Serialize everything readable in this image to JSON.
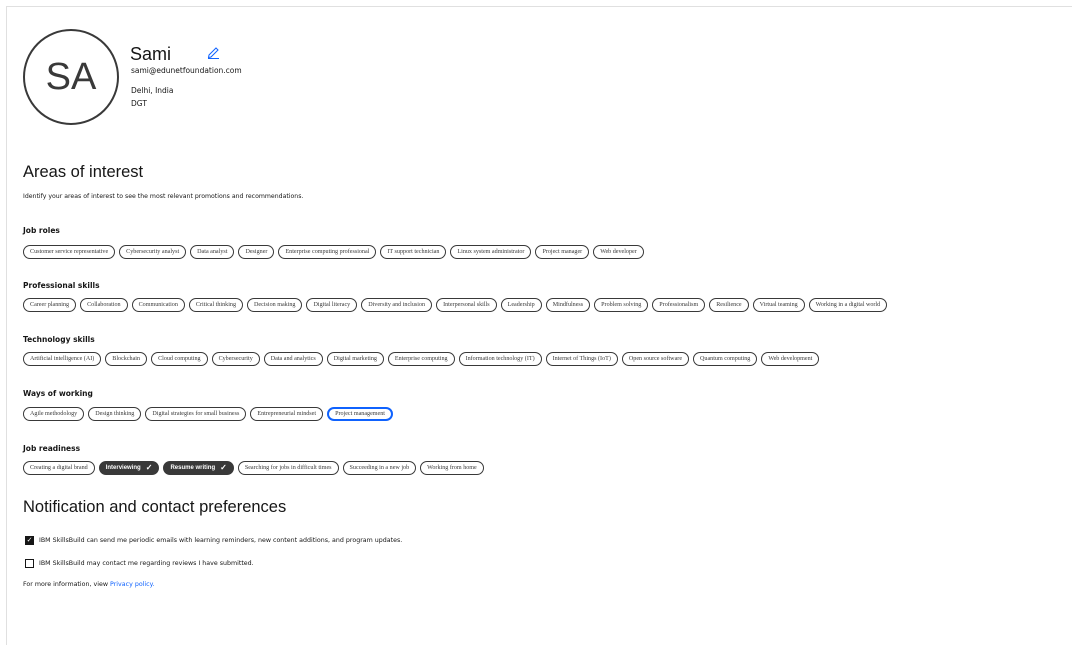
{
  "profile": {
    "initials": "SA",
    "name": "Sami",
    "email": "sami@edunetfoundation.com",
    "location": "Delhi, India",
    "organization": "DGT"
  },
  "areas": {
    "title": "Areas of interest",
    "description": "Identify your areas of interest to see the most relevant promotions and recommendations.",
    "groups": [
      {
        "title": "Job roles",
        "chips": [
          {
            "label": "Customer service representative",
            "selected": false
          },
          {
            "label": "Cybersecurity analyst",
            "selected": false
          },
          {
            "label": "Data analyst",
            "selected": false
          },
          {
            "label": "Designer",
            "selected": false
          },
          {
            "label": "Enterprise computing professional",
            "selected": false
          },
          {
            "label": "IT support technician",
            "selected": false
          },
          {
            "label": "Linux system administrator",
            "selected": false
          },
          {
            "label": "Project manager",
            "selected": false
          },
          {
            "label": "Web developer",
            "selected": false
          }
        ]
      },
      {
        "title": "Professional skills",
        "chips": [
          {
            "label": "Career planning",
            "selected": false
          },
          {
            "label": "Collaboration",
            "selected": false
          },
          {
            "label": "Communication",
            "selected": false
          },
          {
            "label": "Critical thinking",
            "selected": false
          },
          {
            "label": "Decision making",
            "selected": false
          },
          {
            "label": "Digital literacy",
            "selected": false
          },
          {
            "label": "Diversity and inclusion",
            "selected": false
          },
          {
            "label": "Interpersonal skills",
            "selected": false
          },
          {
            "label": "Leadership",
            "selected": false
          },
          {
            "label": "Mindfulness",
            "selected": false
          },
          {
            "label": "Problem solving",
            "selected": false
          },
          {
            "label": "Professionalism",
            "selected": false
          },
          {
            "label": "Resilience",
            "selected": false
          },
          {
            "label": "Virtual teaming",
            "selected": false
          },
          {
            "label": "Working in a digital world",
            "selected": false
          }
        ]
      },
      {
        "title": "Technology skills",
        "chips": [
          {
            "label": "Artificial intelligence (AI)",
            "selected": false
          },
          {
            "label": "Blockchain",
            "selected": false
          },
          {
            "label": "Cloud computing",
            "selected": false
          },
          {
            "label": "Cybersecurity",
            "selected": false
          },
          {
            "label": "Data and analytics",
            "selected": false
          },
          {
            "label": "Digital marketing",
            "selected": false
          },
          {
            "label": "Enterprise computing",
            "selected": false
          },
          {
            "label": "Information technology (IT)",
            "selected": false
          },
          {
            "label": "Internet of Things (IoT)",
            "selected": false
          },
          {
            "label": "Open source software",
            "selected": false
          },
          {
            "label": "Quantum computing",
            "selected": false
          },
          {
            "label": "Web development",
            "selected": false
          }
        ]
      },
      {
        "title": "Ways of working",
        "chips": [
          {
            "label": "Agile methodology",
            "selected": false
          },
          {
            "label": "Design thinking",
            "selected": false
          },
          {
            "label": "Digital strategies for small business",
            "selected": false
          },
          {
            "label": "Entrepreneurial mindset",
            "selected": false
          },
          {
            "label": "Project management",
            "selected": false,
            "focused": true
          }
        ]
      },
      {
        "title": "Job readiness",
        "chips": [
          {
            "label": "Creating a digital brand",
            "selected": false
          },
          {
            "label": "Interviewing",
            "selected": true
          },
          {
            "label": "Resume writing",
            "selected": true
          },
          {
            "label": "Searching for jobs in difficult times",
            "selected": false
          },
          {
            "label": "Succeeding in a new job",
            "selected": false
          },
          {
            "label": "Working from home",
            "selected": false
          }
        ]
      }
    ]
  },
  "notifications": {
    "title": "Notification and contact preferences",
    "options": [
      {
        "label": "IBM SkillsBuild can send me periodic emails with learning reminders, new content additions, and program updates.",
        "checked": true
      },
      {
        "label": "IBM SkillsBuild may contact me regarding reviews I have submitted.",
        "checked": false
      }
    ],
    "info_prefix": "For more information, view ",
    "privacy_link": "Privacy policy."
  },
  "colors": {
    "chip_border": "#393939",
    "chip_selected_bg": "#393939",
    "focus_ring": "#0f62fe",
    "link": "#0f62fe"
  },
  "icons": {
    "edit": "pencil-icon",
    "selected": "checkmark-icon"
  }
}
